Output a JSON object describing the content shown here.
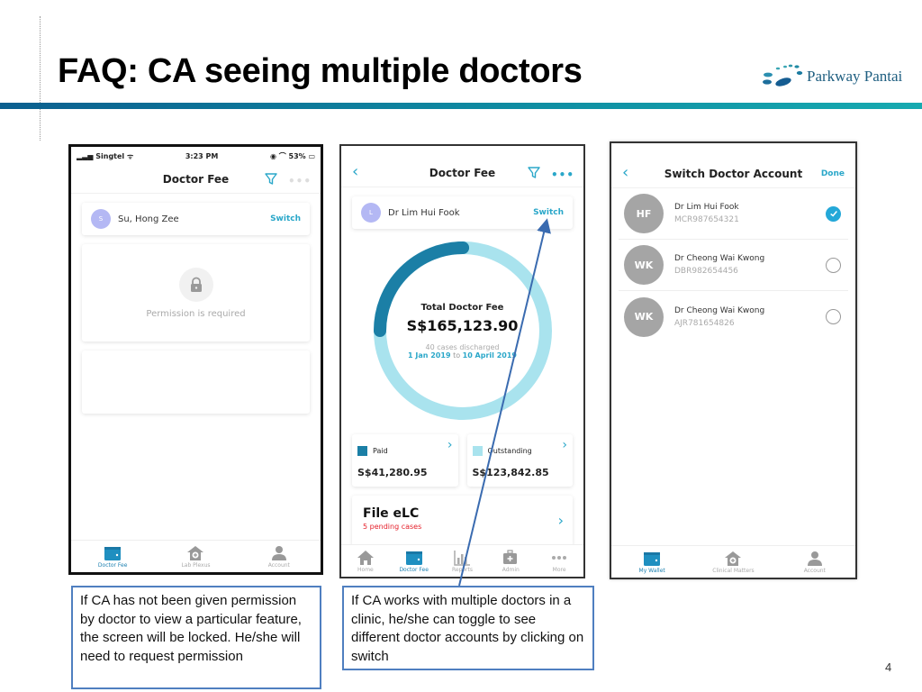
{
  "slide": {
    "title": "FAQ: CA seeing multiple doctors",
    "logo_text": "Parkway Pantai",
    "page_number": "4",
    "accent_color": "#0f8fa3"
  },
  "phone1": {
    "status": {
      "carrier": "Singtel",
      "time": "3:23 PM",
      "battery": "53%"
    },
    "nav_title": "Doctor Fee",
    "doctor": {
      "initial": "S",
      "name": "Su, Hong Zee",
      "switch_label": "Switch"
    },
    "permission_text": "Permission is required",
    "tabs": [
      {
        "label": "Doctor Fee",
        "icon": "wallet-icon",
        "active": true
      },
      {
        "label": "Lab Plexus",
        "icon": "clinic-icon",
        "active": false
      },
      {
        "label": "Account",
        "icon": "person-icon",
        "active": false
      }
    ]
  },
  "phone2": {
    "nav_back": "‹",
    "nav_title": "Doctor Fee",
    "doctor": {
      "initial": "L",
      "name": "Dr Lim Hui Fook",
      "switch_label": "Switch"
    },
    "donut": {
      "label": "Total Doctor Fee",
      "amount": "S$165,123.90",
      "cases": "40 cases discharged",
      "range_start": "1 Jan 2019",
      "range_to": "to",
      "range_end": "10 April 2019",
      "paid_fraction": 0.25,
      "paid_color": "#1b7fa6",
      "outstanding_color": "#a9e3ee"
    },
    "paid": {
      "label": "Paid",
      "amount": "S$41,280.95"
    },
    "outstanding": {
      "label": "Outstanding",
      "amount": "S$123,842.85"
    },
    "elc": {
      "title": "File eLC",
      "pending": "5 pending cases"
    },
    "tabs": [
      {
        "label": "Home",
        "icon": "home-icon",
        "active": false
      },
      {
        "label": "Doctor Fee",
        "icon": "wallet-icon",
        "active": true
      },
      {
        "label": "Reports",
        "icon": "bar-chart-icon",
        "active": false
      },
      {
        "label": "Admin",
        "icon": "medkit-icon",
        "active": false
      },
      {
        "label": "More",
        "icon": "more-icon",
        "active": false
      }
    ]
  },
  "phone3": {
    "nav_back": "‹",
    "nav_title": "Switch Doctor Account",
    "done_label": "Done",
    "accounts": [
      {
        "initials": "HF",
        "name": "Dr Lim Hui Fook",
        "id": "MCR987654321",
        "selected": true
      },
      {
        "initials": "WK",
        "name": "Dr Cheong Wai Kwong",
        "id": "DBR982654456",
        "selected": false
      },
      {
        "initials": "WK",
        "name": "Dr Cheong Wai Kwong",
        "id": "AJR781654826",
        "selected": false
      }
    ],
    "tabs": [
      {
        "label": "My Wallet",
        "icon": "wallet-icon",
        "active": true
      },
      {
        "label": "Clinical Matters",
        "icon": "clinic-icon",
        "active": false
      },
      {
        "label": "Account",
        "icon": "person-icon",
        "active": false
      }
    ]
  },
  "callouts": {
    "left": "If CA has not been given permission by doctor to view a particular feature, the screen will be locked. He/she will need to request permission",
    "right": "If CA works with multiple doctors in a clinic, he/she can toggle to see different doctor accounts by clicking on switch"
  }
}
